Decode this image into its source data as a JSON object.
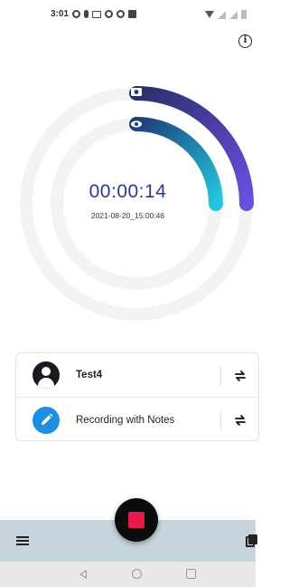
{
  "status_bar": {
    "time": "3:01",
    "left_icons": [
      "circle-icon",
      "mic-icon",
      "mail-icon",
      "circle-icon",
      "circle-icon",
      "image-icon"
    ],
    "right_icons": [
      "wifi-icon",
      "signal-icon",
      "signal-icon",
      "battery-icon"
    ]
  },
  "header": {
    "info_icon": "ⓘ",
    "info_glyph": "i"
  },
  "recorder": {
    "timer": "00:00:14",
    "timestamp": "2021-08-20_15:00:46",
    "outer_ring_icon": "camera-icon",
    "inner_ring_icon": "eye-icon",
    "colors": {
      "outer_arc_start": "#2a2f6a",
      "outer_arc_end": "#6a4fe0",
      "inner_arc_start": "#1d3f7a",
      "inner_arc_end": "#25c6dd",
      "track": "#f3f3f3"
    }
  },
  "cards": {
    "rows": [
      {
        "label": "Test4",
        "icon": "user-avatar-icon",
        "action_icon": "swap-icon"
      },
      {
        "label": "Recording with Notes",
        "icon": "pencil-icon",
        "action_icon": "swap-icon"
      }
    ]
  },
  "bottom_bar": {
    "menu_icon": "hamburger-menu-icon",
    "stop_icon": "stop-icon",
    "library_icon": "library-icon",
    "stop_color": "#e8194d",
    "bar_color": "#c6d4dc"
  },
  "nav_bar": {
    "icons": [
      "back-icon",
      "home-icon",
      "recents-icon"
    ]
  }
}
